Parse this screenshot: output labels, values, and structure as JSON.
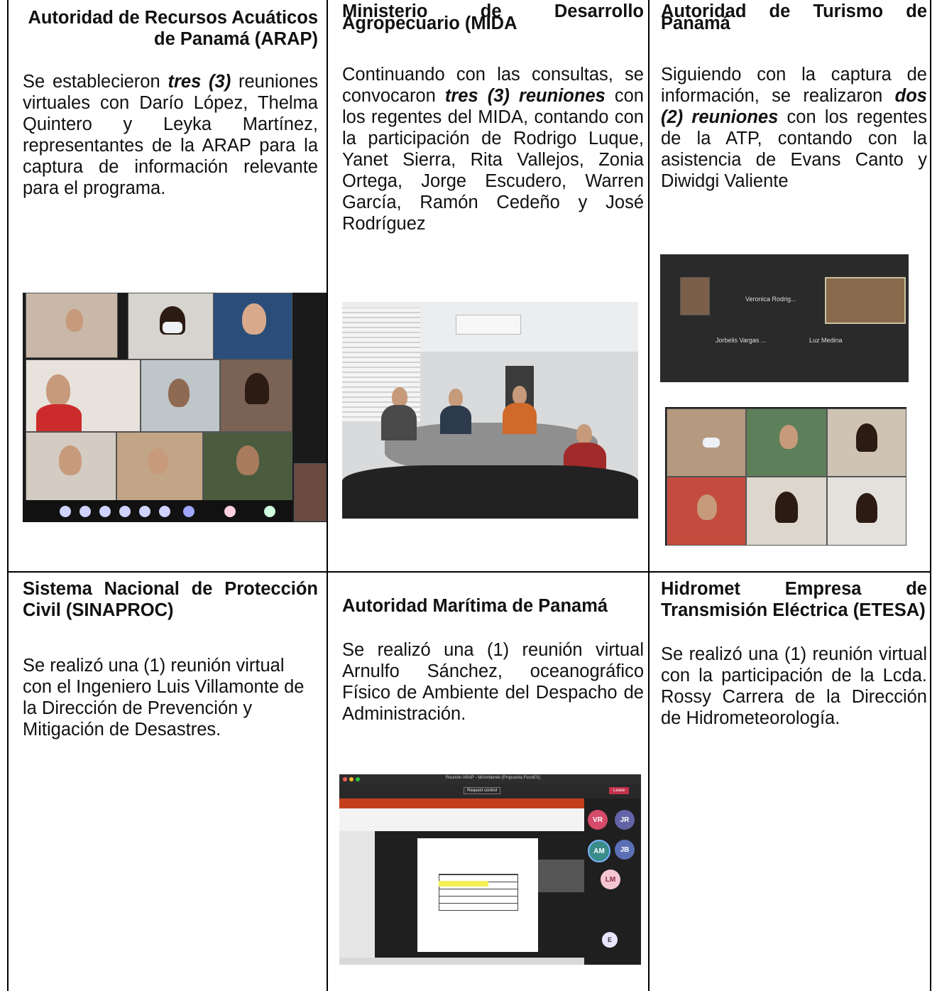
{
  "cells": {
    "arap": {
      "title": "Autoridad de Recursos Acuáticos de Panamá (ARAP)",
      "p_pre": "Se establecieron ",
      "p_em": "tres (3)",
      "p_post": " reuniones virtuales con Darío López, Thelma Quintero y Leyka Martínez, representantes de la ARAP para la captura de información relevante para el programa."
    },
    "mida": {
      "title_line1": "Ministerio de Desarrollo",
      "title_line2": "Agropecuario (MIDA",
      "p_pre": "Continuando con las consultas, se convocaron ",
      "p_em": "tres (3) reuniones",
      "p_post": " con los regentes del MIDA, contando con la participación de Rodrigo Luque, Yanet Sierra, Rita Vallejos, Zonia Ortega, Jorge Escudero, Warren García, Ramón Cedeño y José Rodríguez"
    },
    "atp": {
      "title_line1": "Autoridad de Turismo de",
      "title_line2": "Panamá",
      "p_pre": "Siguiendo con la captura de información, se realizaron ",
      "p_em": "dos (2) reuniones",
      "p_post": " con los regentes de la ATP, contando con la asistencia de Evans Canto y Diwidgi Valiente",
      "call_names": [
        "Veronica Rodrig...",
        "Jorbelis Vargas ...",
        "Luz Medina"
      ]
    },
    "sinaproc": {
      "title": "Sistema Nacional de Protección Civil (SINAPROC)",
      "p": "Se realizó una (1) reunión virtual con el Ingeniero Luis Villamonte de la Dirección de Prevención y Mitigación de Desastres."
    },
    "amp": {
      "title": "Autoridad Marítima de Panamá",
      "p": "Se realizó una (1) reunión virtual Arnulfo Sánchez, oceanográfico Físico de Ambiente del Despacho de Administración.",
      "screen": {
        "window_title": "Reunión ARAP - MiAmbiente (Propuesta FocoES)",
        "request_control": "Request control",
        "leave": "Leave",
        "avatars": [
          "VR",
          "JR",
          "AM",
          "JB",
          "LM",
          "E"
        ]
      }
    },
    "etesa": {
      "title": "Hidromet Empresa de Transmisión Eléctrica (ETESA)",
      "p": "Se realizó una (1) reunión virtual con la participación de la Lcda. Rossy Carrera de la Dirección de Hidrometeorología."
    }
  },
  "colors": {
    "rule": "#000000",
    "call_bg": "#1f1f1f",
    "teams_purple": "#6264a7",
    "ppt_red": "#c43e1c"
  }
}
